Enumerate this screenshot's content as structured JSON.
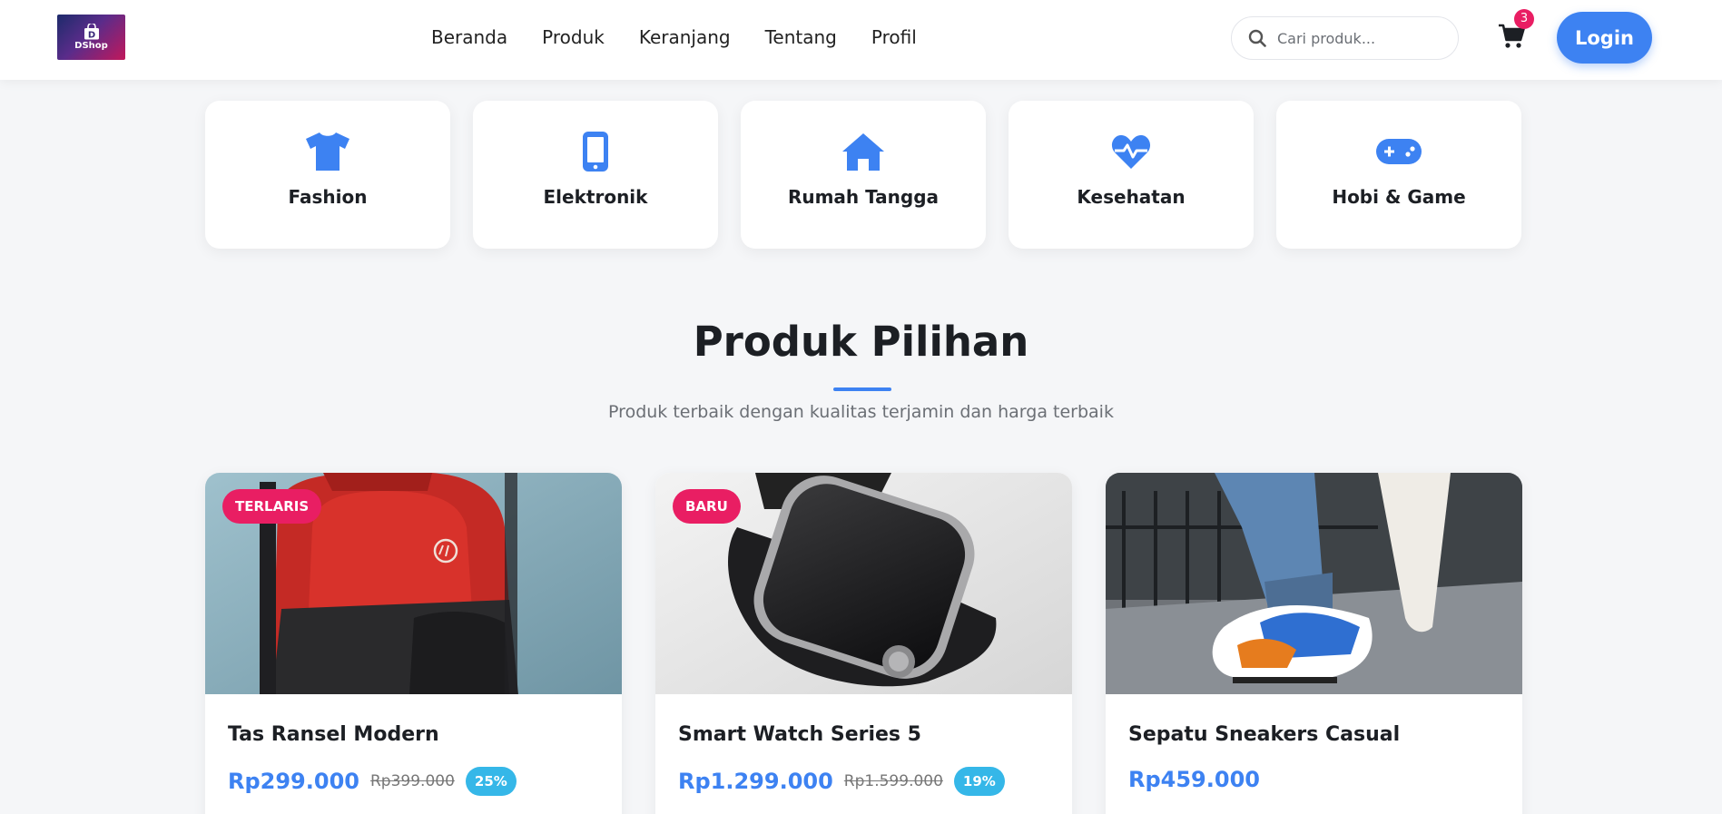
{
  "brand": {
    "logo_text": "DShop",
    "accent": "#3d82f2",
    "badge_color": "#e91e63"
  },
  "nav": {
    "links": [
      "Beranda",
      "Produk",
      "Keranjang",
      "Tentang",
      "Profil"
    ],
    "search_placeholder": "Cari produk...",
    "cart_count": "3",
    "login_label": "Login"
  },
  "categories": [
    {
      "label": "Fashion",
      "icon": "tshirt-icon"
    },
    {
      "label": "Elektronik",
      "icon": "mobile-phone-icon"
    },
    {
      "label": "Rumah Tangga",
      "icon": "home-icon"
    },
    {
      "label": "Kesehatan",
      "icon": "heartbeat-icon"
    },
    {
      "label": "Hobi & Game",
      "icon": "gamepad-icon"
    }
  ],
  "section": {
    "title": "Produk Pilihan",
    "subtitle": "Produk terbaik dengan kualitas terjamin dan harga terbaik"
  },
  "products": [
    {
      "badge": "TERLARIS",
      "name": "Tas Ransel Modern",
      "price": "Rp299.000",
      "old_price": "Rp399.000",
      "discount": "25%",
      "image": "red-backpack-photo"
    },
    {
      "badge": "BARU",
      "name": "Smart Watch Series 5",
      "price": "Rp1.299.000",
      "old_price": "Rp1.599.000",
      "discount": "19%",
      "image": "black-smartwatch-photo"
    },
    {
      "badge": "",
      "name": "Sepatu Sneakers Casual",
      "price": "Rp459.000",
      "old_price": "",
      "discount": "",
      "image": "sneakers-photo"
    }
  ]
}
